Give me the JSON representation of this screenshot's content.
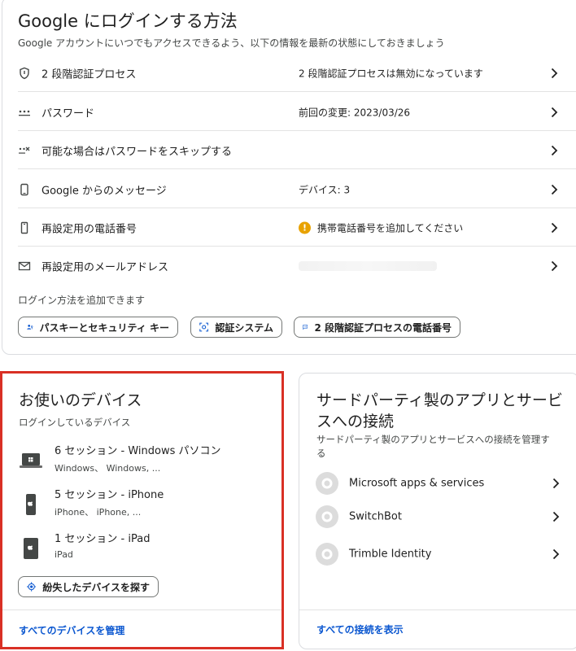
{
  "signin": {
    "title": "Google にログインする方法",
    "subtitle": "Google アカウントにいつでもアクセスできるよう、以下の情報を最新の状態にしておきましょう",
    "rows": [
      {
        "icon": "shield-icon",
        "label": "2 段階認証プロセス",
        "value": "2 段階認証プロセスは無効になっています"
      },
      {
        "icon": "password-dots-icon",
        "label": "パスワード",
        "value": "前回の変更: 2023/03/26"
      },
      {
        "icon": "skip-password-icon",
        "label": "可能な場合はパスワードをスキップする",
        "value": ""
      },
      {
        "icon": "phone-icon",
        "label": "Google からのメッセージ",
        "value": "デバイス: 3"
      },
      {
        "icon": "phone-outline-icon",
        "label": "再設定用の電話番号",
        "value": "携帯電話番号を追加してください",
        "warning": true
      },
      {
        "icon": "mail-icon",
        "label": "再設定用のメールアドレス",
        "value": ""
      }
    ],
    "add_label": "ログイン方法を追加できます",
    "chips": [
      {
        "icon": "passkey-icon",
        "label": "パスキーとセキュリティ キー"
      },
      {
        "icon": "authenticator-icon",
        "label": "認証システム"
      },
      {
        "icon": "sms-icon",
        "label": "2 段階認証プロセスの電話番号"
      }
    ]
  },
  "devices": {
    "title": "お使いのデバイス",
    "subtitle": "ログインしているデバイス",
    "items": [
      {
        "icon": "laptop-windows-icon",
        "name": "6 セッション - Windows パソコン",
        "detail": "Windows、 Windows, ..."
      },
      {
        "icon": "iphone-icon",
        "name": "5 セッション - iPhone",
        "detail": "iPhone、 iPhone, ..."
      },
      {
        "icon": "ipad-icon",
        "name": "1 セッション - iPad",
        "detail": "iPad"
      }
    ],
    "find_button": "紛失したデバイスを探す",
    "manage_link": "すべてのデバイスを管理"
  },
  "third_party": {
    "title_line1": "サードパーティ製のアプリとサービ",
    "title_line2": "スへの接続",
    "subtitle_line1": "サードパーティ製のアプリとサービスへの接続を管理す",
    "subtitle_line2": "る",
    "apps": [
      {
        "name": "Microsoft apps & services"
      },
      {
        "name": "SwitchBot"
      },
      {
        "name": "Trimble Identity"
      }
    ],
    "view_all_link": "すべての接続を表示"
  },
  "colors": {
    "accent": "#0b57d0",
    "highlight_border": "#d93025",
    "warning": "#e8a200"
  }
}
